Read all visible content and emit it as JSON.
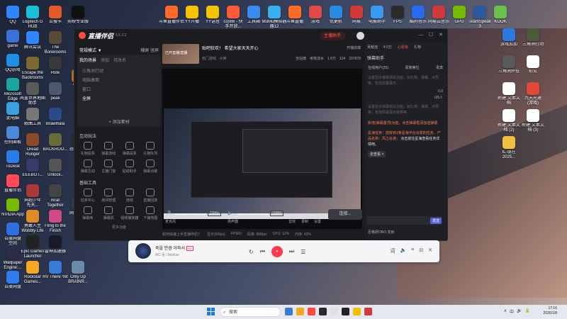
{
  "desktop": {
    "icons_left": [
      {
        "label": "QQ",
        "color": "#2f86ff"
      },
      {
        "label": "game",
        "color": "#3d6fd6"
      },
      {
        "label": "QQ游戏",
        "color": "#1e8fe5"
      },
      {
        "label": "Microsoft Edge",
        "color": "#1aa6a0"
      },
      {
        "label": "此电脑",
        "color": "#3aa0e0"
      },
      {
        "label": "控制面板",
        "color": "#4c88d8"
      },
      {
        "label": "ToDesk",
        "color": "#2a7de2"
      },
      {
        "label": "直播伴侣",
        "color": "#ff4a5a"
      },
      {
        "label": "NVIDIA App",
        "color": "#76b900"
      },
      {
        "label": "百度网盘\n空间",
        "color": "#2f6fe0"
      },
      {
        "label": "Wallpaper Engine:...",
        "color": "#2c2c4a"
      },
      {
        "label": "百度网盘",
        "color": "#2f7bf0"
      }
    ],
    "icons_col2": [
      {
        "label": "Logitech G HUB",
        "color": "#18c0d8"
      },
      {
        "label": "腾讯会议",
        "color": "#2f86ff"
      },
      {
        "label": "Escape the Backrooms",
        "color": "#7a6a30"
      },
      {
        "label": "两重世界地图\n助手",
        "color": "#5a5a5a"
      },
      {
        "label": "歌曲工具",
        "color": "#777"
      },
      {
        "label": "Dread Hunger",
        "color": "#8a4a2a"
      },
      {
        "label": "EEEBOT...",
        "color": "#3a3a6a"
      },
      {
        "label": "奔跑少年\n先天...",
        "color": "#aa3a3a"
      },
      {
        "label": "勇敢人生\nWobbly Life",
        "color": "#e08a2a"
      },
      {
        "label": "Epic Games Launcher",
        "color": "#222"
      },
      {
        "label": "Rockstar Games...",
        "color": "#f5a623"
      }
    ],
    "icons_col3": [
      {
        "label": "百搜卡",
        "color": "#e05a2a"
      },
      {
        "label": "The Bonerooms",
        "color": "#5a4a3a"
      },
      {
        "label": "Ride",
        "color": "#3a3a3a"
      },
      {
        "label": "peak",
        "color": "#4a5a6a"
      },
      {
        "label": "Brawlhala",
        "color": "#2a4a8a"
      },
      {
        "label": "BACKROO...",
        "color": "#6a6a3a"
      },
      {
        "label": "Unlock..",
        "color": "#555"
      },
      {
        "label": "Bcat Together",
        "color": "#444"
      },
      {
        "label": "Fling to the Finish",
        "color": "#d04a8a"
      },
      {
        "label": "雷神加速器",
        "color": "#1a1a2a"
      },
      {
        "label": "RV There Yet",
        "color": "#3a7ad8"
      }
    ],
    "icons_col4": [
      {
        "label": "剪映专业版",
        "color": "#111"
      },
      {
        "label": "We...",
        "color": "#aa6a2a"
      },
      {
        "label": "恐怖游戏\n的...",
        "color": "#2a2a2a"
      },
      {
        "label": "网易外挂",
        "color": "#3a3a3a"
      },
      {
        "label": "Only Up BRAINR...",
        "color": "#6a8aaa"
      }
    ],
    "icons_top": [
      {
        "label": "斗鱼直播伴侣",
        "color": "#ff6a2a"
      },
      {
        "label": "YY开播",
        "color": "#f5c400"
      },
      {
        "label": "YY语音",
        "color": "#f5c400"
      },
      {
        "label": "cos66 - 快\n手开放...",
        "color": "#ff5a3a"
      },
      {
        "label": "工具箱",
        "color": "#3a8af0"
      },
      {
        "label": "MuMu模拟器\n器12",
        "color": "#3ab0f0"
      },
      {
        "label": "斗鱼直播",
        "color": "#ff6a2a"
      },
      {
        "label": "游戏",
        "color": "#e04a4a"
      },
      {
        "label": "优更机",
        "color": "#2a8ae0"
      },
      {
        "label": "网易",
        "color": "#d03a3a"
      },
      {
        "label": "电报助手",
        "color": "#3a9af0"
      },
      {
        "label": "FPS",
        "color": "#2a2a2a"
      },
      {
        "label": "酷狗音乐",
        "color": "#2a6af0"
      },
      {
        "label": "网易云音乐",
        "color": "#d03a3a"
      },
      {
        "label": "GPU",
        "color": "#76b900"
      },
      {
        "label": "TeamSpeak 3",
        "color": "#2a5aa0"
      },
      {
        "label": "KOOK",
        "color": "#6ac04a"
      }
    ],
    "icons_right": [
      {
        "label": "游戏加加",
        "color": "#2a7ae0"
      },
      {
        "label": "三角洲行动",
        "color": "#4a5a3a"
      },
      {
        "label": "三角洲外挂",
        "color": "#5a5a5a"
      },
      {
        "label": "初见",
        "color": "#ffffff"
      },
      {
        "label": "新建 文本文\n档",
        "color": "#ffffff"
      },
      {
        "label": "九天光速\n(游戏)",
        "color": "#e04a3a"
      },
      {
        "label": "新建 文本文\n档 (2)",
        "color": "#ffffff"
      },
      {
        "label": "新建 文本文\n档 (3)",
        "color": "#ffffff"
      },
      {
        "label": "IL·现在\n2025...",
        "color": "#f0c040"
      }
    ]
  },
  "app": {
    "name": "直播伴侣",
    "version": "6.5.3.2",
    "live_button": "主播助手",
    "mode_label": "常规模式 ▼",
    "mode_right": "横屏  竖屏",
    "scene_tabs": [
      "我的场景",
      "添加",
      "可改名"
    ],
    "scenes": [
      "三角洲行动",
      "电脑桌面",
      "窗口",
      "全屏"
    ],
    "add_source": "+ 添加素材",
    "interactive_title": "互动玩法",
    "interactive_tools": [
      "礼物投票",
      "弹幕游戏",
      "弹幕投票",
      "礼物队列",
      "弹幕互动",
      "主播门徒",
      "贴纸助手",
      "弹幕点歌"
    ],
    "basic_title": "基础工具",
    "basic_tools": [
      "任务中心",
      "房间管理",
      "连线",
      "直播回放",
      "弹幕库",
      "弹幕机",
      "视频播放器",
      "下播地图"
    ],
    "more_functions": "更多功能",
    "room_title": "贴吧狂欢！ 希望大家天天开心",
    "room_category": "热门游戏 · 大神",
    "room_notice": "开播前端",
    "room_thumb_label": "已开直播/直播",
    "room_stats": [
      "全站榜",
      "考核流水",
      "1.6万",
      "124",
      "237878"
    ],
    "mic_label": "麦克风",
    "mic_pct": "100%",
    "speaker_label": "扬声器",
    "speaker_pct": "100%",
    "effects": [
      "音效",
      "录制",
      "设置"
    ],
    "start_button": "连接...",
    "status_items": [
      "如何快速上手直播伴侣？",
      "显示(60fps)",
      "FPS60",
      "码率: 8Mbps",
      "CPU: 12%",
      "内存: 42%"
    ]
  },
  "right_panel": {
    "tabs": [
      "贡献值",
      "心愿单",
      "心愿",
      "礼物",
      "PK",
      "礼物"
    ],
    "tab_coin": "¥ 0万",
    "header": "弹幕助手",
    "subtabs": [
      "在线用户(25)",
      "贵族席位",
      "贵宾"
    ],
    "hint1": "设置显示弹幕相关功能，如礼物、弹幕、点赞等，包括屏幕展示...",
    "score_label": "0.0",
    "count_label": "0/5人",
    "hint2": "设置显示弹幕相关功能，如礼物、弹幕、点赞等，包括屏幕展示效果等",
    "msg1": "新增(弹幕置顶)功能，点击弹幕框添加送弹幕",
    "msg2_a": "星海任务：您收到1条星海平台派发的任务，产品名称：风之谷游，",
    "msg2_b": "点击前往星海查看任务详情吧。",
    "see_button": "去查看 >",
    "send_button": "发送",
    "user_label": "尼格妍OBO  发射",
    "chip_count": "1"
  },
  "player": {
    "song": "죽을 만큼 아파서",
    "badge": "VIP",
    "artist": "MC 몽 / Mellow",
    "controls": [
      "↻",
      "⏮",
      "⏸",
      "⏭",
      "☰"
    ]
  },
  "taskbar": {
    "search_placeholder": "搜索",
    "time": "17:16",
    "date": "2026/1/8",
    "tray": [
      "∧",
      "中",
      "🔊",
      "🔋"
    ]
  }
}
